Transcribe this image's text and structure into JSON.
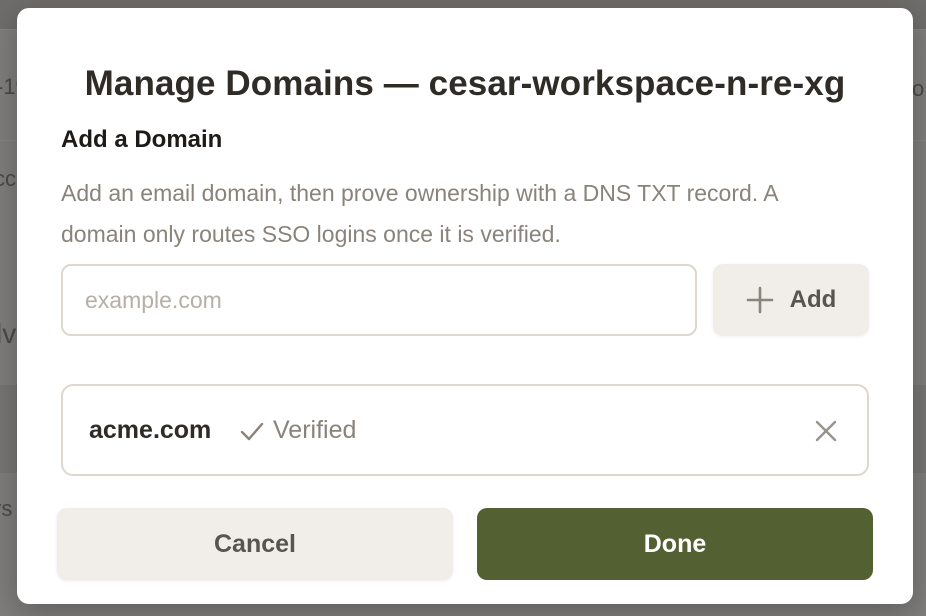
{
  "dialog": {
    "title": "Manage Domains — cesar-workspace-n-re-xg",
    "section_title": "Add a Domain",
    "section_description": "Add an email domain, then prove ownership with a DNS TXT record. A domain only routes SSO logins once it is verified.",
    "domain_input": {
      "placeholder": "example.com",
      "value": ""
    },
    "add_button": {
      "label": "Add",
      "icon": "plus-icon"
    },
    "domains": [
      {
        "name": "acme.com",
        "status": "Verified",
        "status_icon": "check-icon",
        "remove_icon": "close-icon"
      }
    ],
    "cancel_label": "Cancel",
    "done_label": "Done"
  },
  "colors": {
    "primary": "#536032",
    "secondary_button": "#f1eeea",
    "muted_text": "#8a837c",
    "border": "#ddd7cf"
  }
}
